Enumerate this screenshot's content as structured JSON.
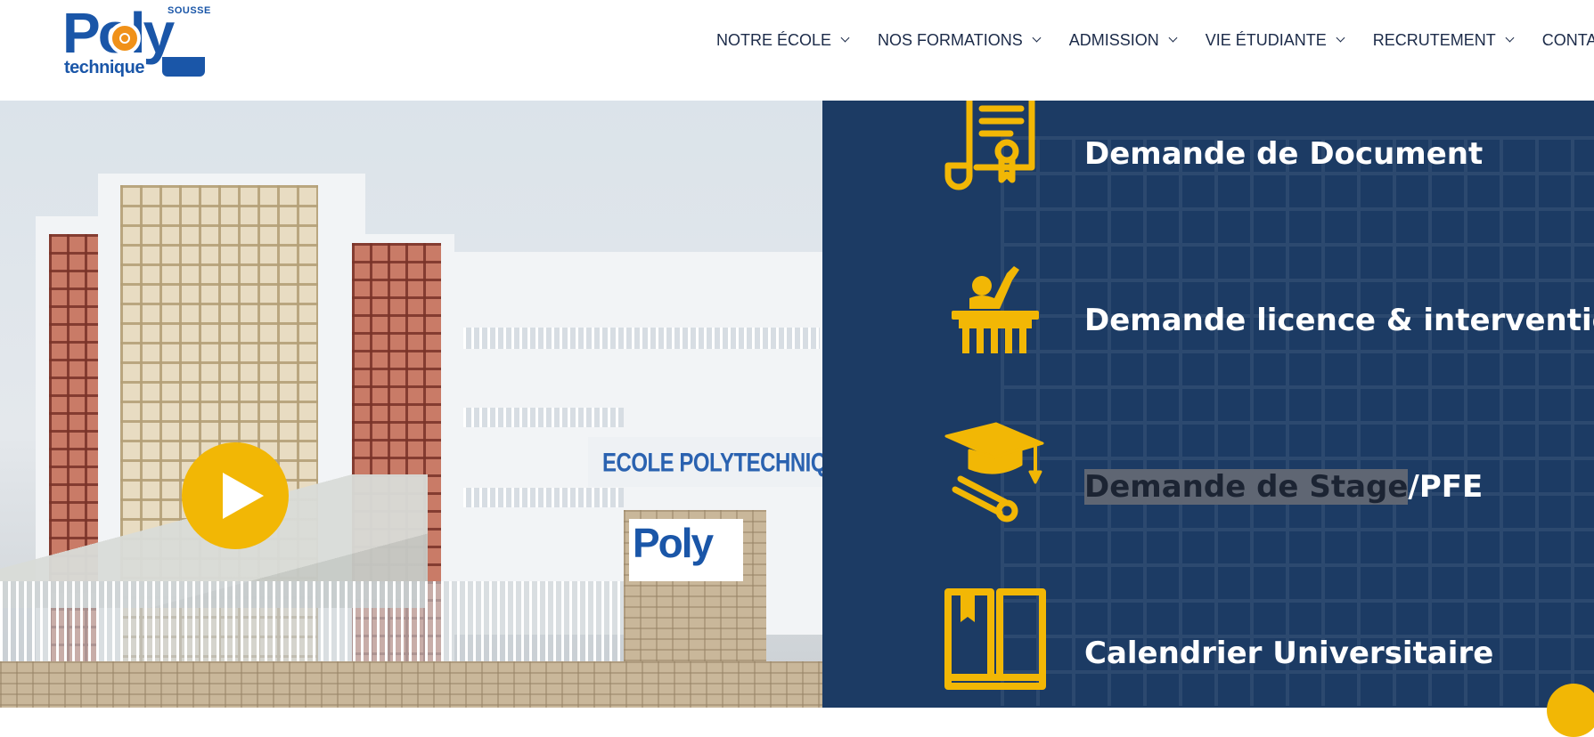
{
  "logo": {
    "top_text": "SOUSSE",
    "main_text": "Poly",
    "bottom_text": "technique"
  },
  "nav": [
    {
      "label": "NOTRE ÉCOLE",
      "has_dropdown": true,
      "icon": "chevron-down-icon"
    },
    {
      "label": "NOS FORMATIONS",
      "has_dropdown": true,
      "icon": "chevron-down-icon"
    },
    {
      "label": "ADMISSION",
      "has_dropdown": true,
      "icon": "chevron-down-icon"
    },
    {
      "label": "VIE ÉTUDIANTE",
      "has_dropdown": true,
      "icon": "chevron-down-icon"
    },
    {
      "label": "RECRUTEMENT",
      "has_dropdown": true,
      "icon": "chevron-down-icon"
    },
    {
      "label": "CONTACT",
      "has_dropdown": false
    }
  ],
  "hero": {
    "sign_text": "ECOLE POLYTECHNIQUE DE SOUSSE",
    "sign_logo_text": "Poly",
    "play_icon": "play-icon"
  },
  "services": [
    {
      "icon": "scroll-certificate-icon",
      "label_before": "Demande de Document",
      "label_selected": "",
      "label_after": ""
    },
    {
      "icon": "student-raising-hand-icon",
      "label_before": "Demande licence & intervention",
      "label_selected": "",
      "label_after": ""
    },
    {
      "icon": "graduation-cap-diploma-icon",
      "label_before": "",
      "label_selected": "Demande de Stage",
      "label_after": "/PFE"
    },
    {
      "icon": "open-book-icon",
      "label_before": "Calendrier Universitaire",
      "label_selected": "",
      "label_after": ""
    }
  ],
  "colors": {
    "brand_blue": "#1a56a8",
    "panel_navy": "#1c3b64",
    "accent_yellow": "#f2b705",
    "nav_text": "#1b2a48",
    "logo_orange": "#f09119"
  }
}
